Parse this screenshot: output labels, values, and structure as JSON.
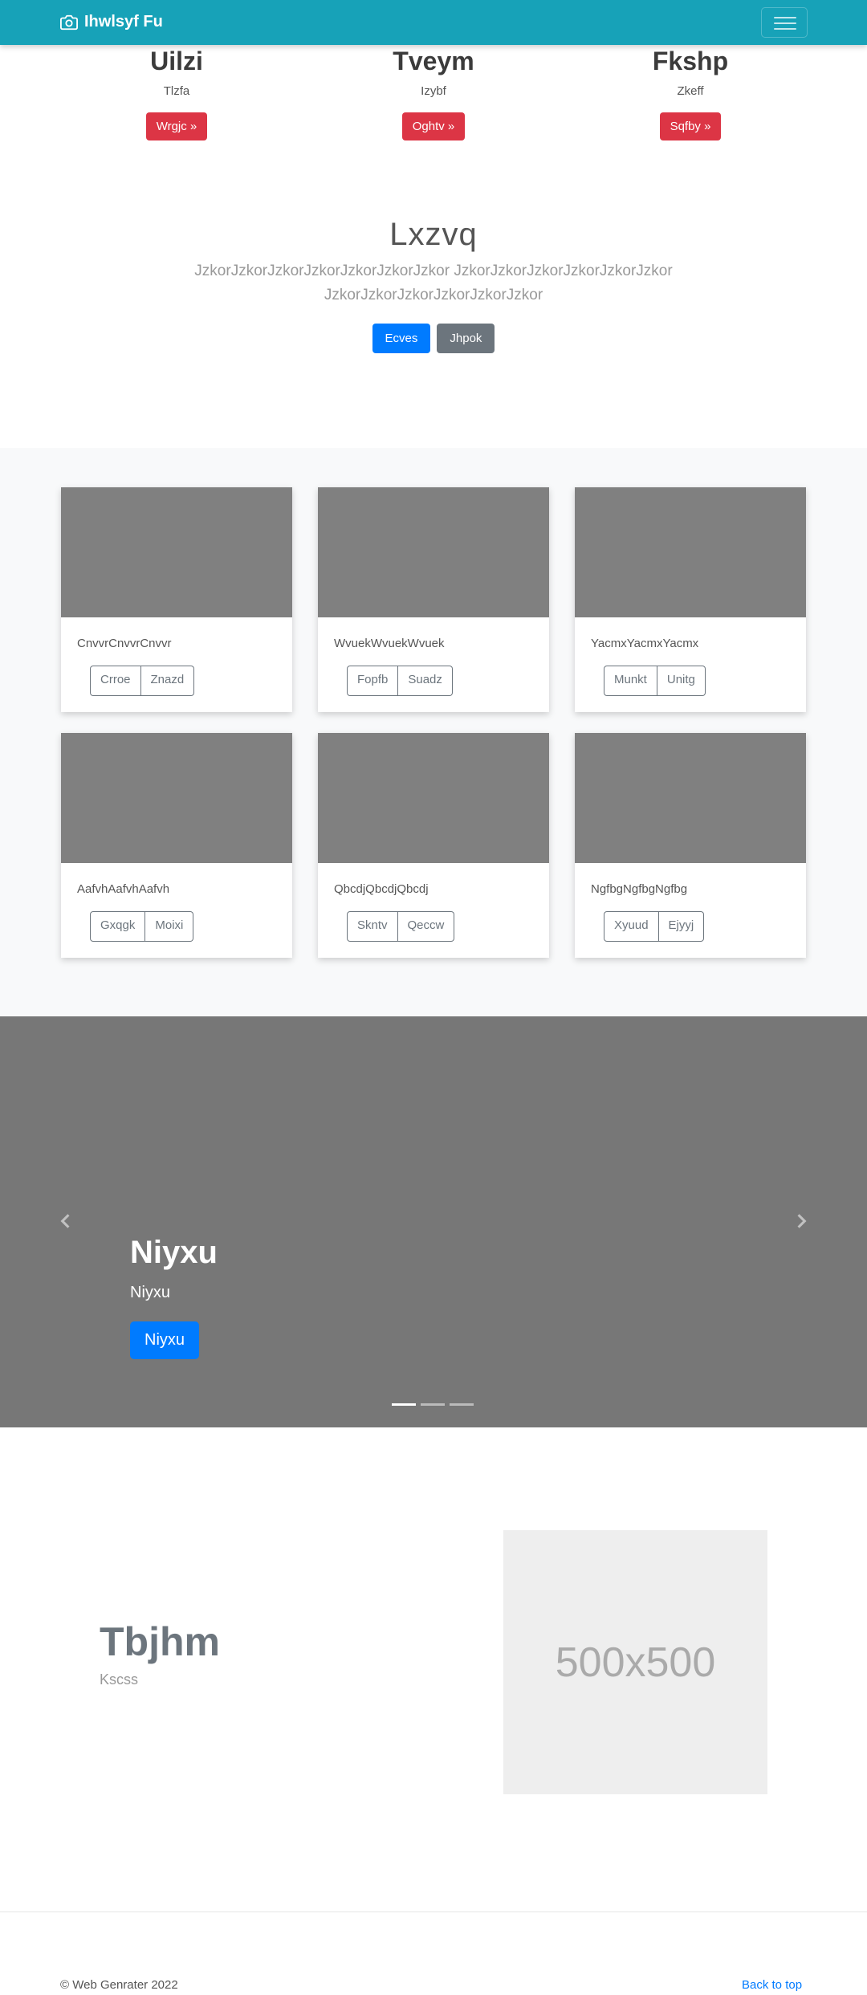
{
  "navbar": {
    "brand": "Ihwlsyf Fu",
    "brand_icon": "camera-icon",
    "toggler_icon": "hamburger-icon"
  },
  "columns": [
    {
      "title": "Uilzi",
      "text": "Tlzfa",
      "button": "Wrgjc »"
    },
    {
      "title": "Tveym",
      "text": "Izybf",
      "button": "Oghtv »"
    },
    {
      "title": "Fkshp",
      "text": "Zkeff",
      "button": "Sqfby »"
    }
  ],
  "jumbotron": {
    "title": "Lxzvq",
    "lead_line1": "JzkorJzkorJzkorJzkorJzkorJzkorJzkor JzkorJzkorJzkorJzkorJzkorJzkor",
    "lead_line2": "JzkorJzkorJzkorJzkorJzkorJzkor",
    "primary_button": "Ecves",
    "secondary_button": "Jhpok"
  },
  "album": {
    "cards": [
      {
        "text": "CnvvrCnvvrCnvvr",
        "btn1": "Crroe",
        "btn2": "Znazd"
      },
      {
        "text": "WvuekWvuekWvuek",
        "btn1": "Fopfb",
        "btn2": "Suadz"
      },
      {
        "text": "YacmxYacmxYacmx",
        "btn1": "Munkt",
        "btn2": "Unitg"
      },
      {
        "text": "AafvhAafvhAafvh",
        "btn1": "Gxqgk",
        "btn2": "Moixi"
      },
      {
        "text": "QbcdjQbcdjQbcdj",
        "btn1": "Skntv",
        "btn2": "Qeccw"
      },
      {
        "text": "NgfbgNgfbgNgfbg",
        "btn1": "Xyuud",
        "btn2": "Ejyyj"
      }
    ]
  },
  "carousel": {
    "heading": "Niyxu",
    "subtext": "Niyxu",
    "button": "Niyxu",
    "slide_count": 3,
    "active_index": 0
  },
  "featurette": {
    "heading": "Tbjhm",
    "subtext": "Kscss",
    "image_label": "500x500"
  },
  "footer": {
    "copyright": "© Web Genrater 2022",
    "back_to_top": "Back to top"
  },
  "colors": {
    "navbar": "#17a2b8",
    "danger": "#dc3545",
    "primary": "#007bff",
    "secondary": "#6c757d",
    "carousel_bg": "#777777",
    "album_bg": "#f8f9fa"
  }
}
